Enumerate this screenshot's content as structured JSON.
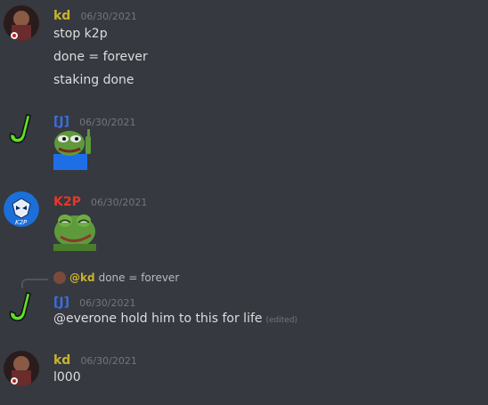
{
  "messages": [
    {
      "author": "kd",
      "author_color": "#c9b430",
      "timestamp": "06/30/2021",
      "lines": [
        "stop k2p",
        "done = forever",
        "staking done"
      ]
    },
    {
      "author": "[J]",
      "author_color": "#3b6fe0",
      "timestamp": "06/30/2021",
      "attachment": "pepe-pointing-emoji"
    },
    {
      "author": "K2P",
      "author_color": "#e8362a",
      "timestamp": "06/30/2021",
      "attachment": "pepe-smug-emoji"
    },
    {
      "author": "[J]",
      "author_color": "#3b6fe0",
      "timestamp": "06/30/2021",
      "reply_to": {
        "author": "@kd",
        "text": "done = forever"
      },
      "text": "@everone hold him to this for life",
      "edited": "(edited)"
    },
    {
      "author": "kd",
      "author_color": "#c9b430",
      "timestamp": "06/30/2021",
      "text": "l000"
    }
  ]
}
